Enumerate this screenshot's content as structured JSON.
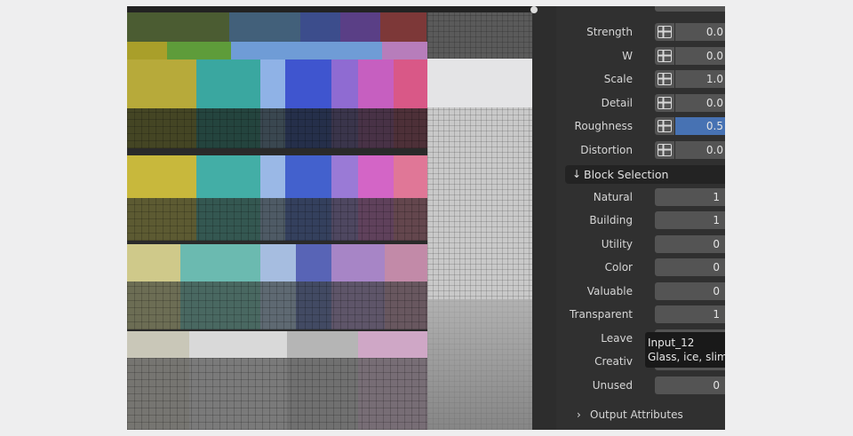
{
  "properties": {
    "noise_rows": [
      {
        "label": "Strength",
        "value": "0.0",
        "active": false
      },
      {
        "label": "W",
        "value": "0.0",
        "active": false
      },
      {
        "label": "Scale",
        "value": "1.0",
        "active": false
      },
      {
        "label": "Detail",
        "value": "0.0",
        "active": false
      },
      {
        "label": "Roughness",
        "value": "0.5",
        "active": true
      },
      {
        "label": "Distortion",
        "value": "0.0",
        "active": false
      }
    ],
    "block_selection": {
      "arrow": "↓",
      "title": "Block Selection",
      "rows": [
        {
          "label": "Natural",
          "value": "1"
        },
        {
          "label": "Building",
          "value": "1"
        },
        {
          "label": "Utility",
          "value": "0"
        },
        {
          "label": "Color",
          "value": "0"
        },
        {
          "label": "Valuable",
          "value": "0"
        },
        {
          "label": "Transparent",
          "value": "1"
        },
        {
          "label": "Leave",
          "value": ""
        },
        {
          "label": "Creativ",
          "value": ""
        },
        {
          "label": "Unused",
          "value": "0"
        }
      ]
    },
    "output_attributes": {
      "chevron": "›",
      "label": "Output Attributes"
    }
  },
  "tooltip": {
    "line1": "Input_12",
    "line2": "Glass, ice, slime"
  },
  "icons": {
    "socket": "socket-icon",
    "cursor": "mouse-cursor-icon",
    "panel_pin": "pin-icon"
  },
  "colors": {
    "panel_bg": "#303030",
    "field_bg": "#545454",
    "active_field": "#4772b3",
    "header_bg": "#232323",
    "tooltip_bg": "#191919"
  }
}
